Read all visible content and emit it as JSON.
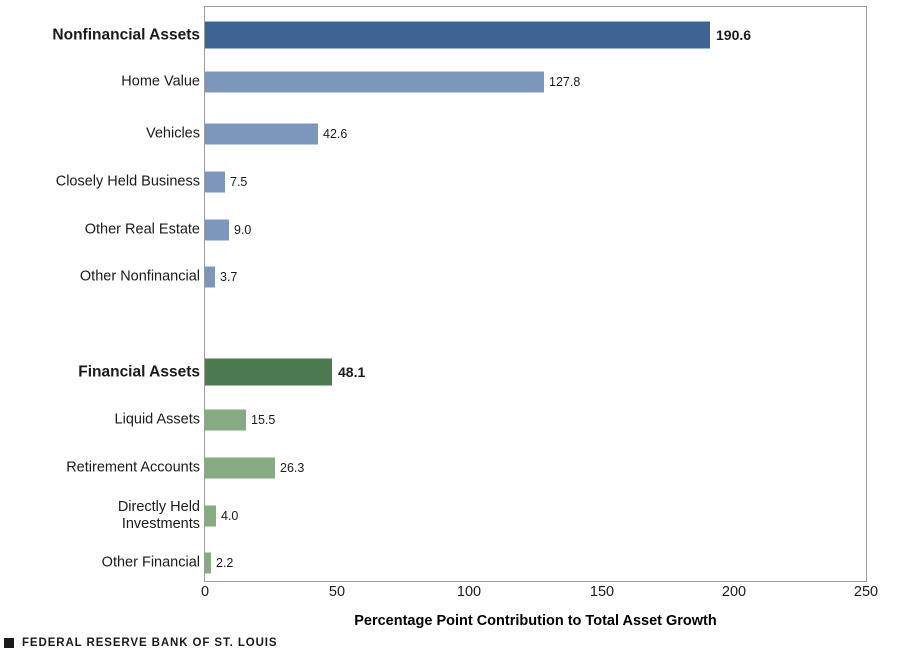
{
  "chart_data": {
    "type": "bar",
    "orientation": "horizontal",
    "title": "",
    "xlabel": "Percentage Point Contribution to Total Asset Growth",
    "ylabel": "",
    "xlim": [
      0,
      250
    ],
    "xticks": [
      "0",
      "50",
      "100",
      "150",
      "200",
      "250"
    ],
    "grid": false,
    "legend": null,
    "categories": [
      "Nonfinancial Assets",
      "Home Value",
      "Vehicles",
      "Closely Held Business",
      "Other Real Estate",
      "Other Nonfinancial",
      "",
      "Financial Assets",
      "Liquid Assets",
      "Retirement Accounts",
      "Directly Held\nInvestments",
      "Other Financial"
    ],
    "values": [
      190.6,
      127.8,
      42.6,
      7.5,
      9.0,
      3.7,
      null,
      48.1,
      15.5,
      26.3,
      4.0,
      2.2
    ],
    "value_labels": [
      "190.6",
      "127.8",
      "42.6",
      "7.5",
      "9.0",
      "3.7",
      "",
      "48.1",
      "15.5",
      "26.3",
      "4.0",
      "2.2"
    ],
    "bars": [
      {
        "label": "Nonfinancial Assets",
        "value": 190.6,
        "value_label": "190.6",
        "color": "#3d6492",
        "emphasis": true
      },
      {
        "label": "Home Value",
        "value": 127.8,
        "value_label": "127.8",
        "color": "#7d96bb",
        "emphasis": false
      },
      {
        "label": "Vehicles",
        "value": 42.6,
        "value_label": "42.6",
        "color": "#7d96bb",
        "emphasis": false
      },
      {
        "label": "Closely Held Business",
        "value": 7.5,
        "value_label": "7.5",
        "color": "#7d96bb",
        "emphasis": false
      },
      {
        "label": "Other Real Estate",
        "value": 9.0,
        "value_label": "9.0",
        "color": "#7d96bb",
        "emphasis": false
      },
      {
        "label": "Other Nonfinancial",
        "value": 3.7,
        "value_label": "3.7",
        "color": "#7d96bb",
        "emphasis": false
      },
      {
        "label": "Financial Assets",
        "value": 48.1,
        "value_label": "48.1",
        "color": "#4a7a4e",
        "emphasis": true
      },
      {
        "label": "Liquid Assets",
        "value": 15.5,
        "value_label": "15.5",
        "color": "#86ab80",
        "emphasis": false
      },
      {
        "label": "Retirement Accounts",
        "value": 26.3,
        "value_label": "26.3",
        "color": "#86ab80",
        "emphasis": false
      },
      {
        "label": "Directly Held\nInvestments",
        "value": 4.0,
        "value_label": "4.0",
        "color": "#86ab80",
        "emphasis": false
      },
      {
        "label": "Other Financial",
        "value": 2.2,
        "value_label": "2.2",
        "color": "#86ab80",
        "emphasis": false
      }
    ],
    "colors": {
      "nonfinancial_total": "#3d6492",
      "nonfinancial_component": "#7d96bb",
      "financial_total": "#4a7a4e",
      "financial_component": "#86ab80",
      "frame": "#9b9b9b"
    }
  },
  "footer": {
    "text": "FEDERAL RESERVE BANK OF ST. LOUIS",
    "mark": "square-mark"
  }
}
